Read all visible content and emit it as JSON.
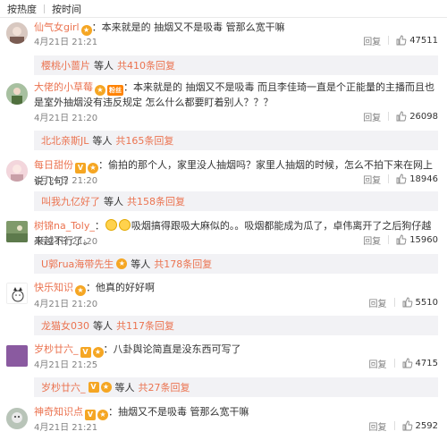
{
  "sort": {
    "hot_label": "按热度",
    "time_label": "按时间"
  },
  "common": {
    "reply_label": "回复",
    "others_label": "等人"
  },
  "comments": [
    {
      "user": "仙气女girl",
      "separator": "：",
      "text": "本来就是的 抽烟又不是吸毒 管那么宽干嘛",
      "time": "4月21日 21:21",
      "likes": "47511",
      "sub": {
        "user": "樱桃小蔷片",
        "count_text": "共410条回复"
      }
    },
    {
      "user": "大佬的小草莓",
      "separator": "：",
      "text": "本来就是的 抽烟又不是吸毒 而且李佳琦一直是个正能量的主播而且也是室外抽烟没有违反规定 怎么什么都要盯着别人？？？",
      "time": "4月21日 21:20",
      "likes": "26098",
      "sub": {
        "user": "北北亲斯JL",
        "count_text": "共165条回复"
      }
    },
    {
      "user": "每日甜份",
      "separator": "：",
      "text": "偷拍的那个人，家里没人抽烟吗？家里人抽烟的时候，怎么不拍下来在网上说几句？",
      "time": "4月21日 21:20",
      "likes": "18946",
      "sub": {
        "user": "叫我九亿好了",
        "count_text": "共158条回复"
      }
    },
    {
      "user": "树锦na_Toly_",
      "separator": "：",
      "text": "吸烟搞得跟吸大麻似的。。吸烟都能成为瓜了，卓伟离开了之后狗仔越来越不行了。",
      "time": "4月21日 21:20",
      "likes": "15960",
      "sub": {
        "user": "U郭rua海带先生",
        "count_text": "共178条回复"
      }
    },
    {
      "user": "快乐知识",
      "separator": "：",
      "text": "他真的好好啊",
      "time": "4月21日 21:20",
      "likes": "5510",
      "sub": {
        "user": "龙猫女030",
        "count_text": "共117条回复"
      }
    },
    {
      "user": "岁杪廿六_",
      "separator": "：",
      "text": "八卦舆论简直是没东西可写了",
      "time": "4月21日 21:25",
      "likes": "4715",
      "sub": {
        "user": "岁杪廿六_",
        "count_text": "共27条回复"
      }
    },
    {
      "user": "神奇知识点",
      "separator": "：",
      "text": "抽烟又不是吸毒 管那么宽干嘛",
      "time": "4月21日 21:21",
      "likes": "2592"
    }
  ]
}
